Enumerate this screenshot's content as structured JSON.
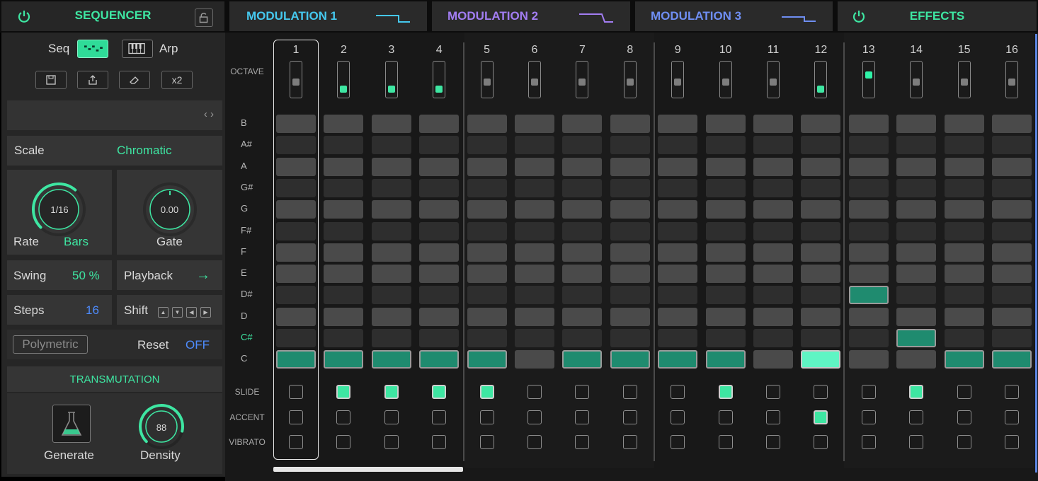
{
  "tabs": {
    "sequencer": "SEQUENCER",
    "modulation1": "MODULATION 1",
    "modulation2": "MODULATION 2",
    "modulation3": "MODULATION 3",
    "effects": "EFFECTS"
  },
  "left": {
    "seq_label": "Seq",
    "arp_label": "Arp",
    "x2_label": "x2",
    "preset_nav": "‹ ›",
    "scale_label": "Scale",
    "scale_value": "Chromatic",
    "rate_value": "1/16",
    "rate_label": "Rate",
    "rate_mode": "Bars",
    "gate_value": "0.00",
    "gate_label": "Gate",
    "swing_label": "Swing",
    "swing_value": "50 %",
    "playback_label": "Playback",
    "playback_arrow": "→",
    "steps_label": "Steps",
    "steps_value": "16",
    "shift_label": "Shift",
    "polymetric_label": "Polymetric",
    "reset_label": "Reset",
    "reset_value": "OFF",
    "transmutation": "TRANSMUTATION",
    "generate_label": "Generate",
    "density_value": "88",
    "density_label": "Density",
    "rate_fraction": 0.65,
    "density_fraction": 0.88
  },
  "grid": {
    "octave_label": "OCTAVE",
    "note_rows": [
      "B",
      "A#",
      "A",
      "G#",
      "G",
      "F#",
      "F",
      "E",
      "D#",
      "D",
      "C#",
      "C"
    ],
    "slide_label": "SLIDE",
    "accent_label": "ACCENT",
    "vibrato_label": "VIBRATO",
    "steps": [
      "1",
      "2",
      "3",
      "4",
      "5",
      "6",
      "7",
      "8",
      "9",
      "10",
      "11",
      "12",
      "13",
      "14",
      "15",
      "16"
    ],
    "octave_levels": [
      0,
      -1,
      -1,
      -1,
      0,
      0,
      0,
      0,
      0,
      0,
      0,
      -1,
      1,
      0,
      0,
      0
    ],
    "notes": [
      "C",
      "C",
      "C",
      "C",
      "C",
      null,
      "C",
      "C",
      "C",
      "C",
      null,
      "C",
      "D#",
      "C#",
      "C",
      "C"
    ],
    "bright_step": 12,
    "slide": [
      false,
      true,
      true,
      true,
      true,
      false,
      false,
      false,
      false,
      true,
      false,
      false,
      false,
      true,
      false,
      false
    ],
    "accent": [
      false,
      false,
      false,
      false,
      false,
      false,
      false,
      false,
      false,
      false,
      false,
      true,
      false,
      false,
      false,
      false
    ],
    "vibrato": [
      false,
      false,
      false,
      false,
      false,
      false,
      false,
      false,
      false,
      false,
      false,
      false,
      false,
      false,
      false,
      false
    ]
  },
  "colors": {
    "accent_green": "#3ee6a2",
    "mod1_cyan": "#45c8ee",
    "mod2_purple": "#a27df2",
    "mod3_blue": "#6f8ef2"
  },
  "icons": {
    "power": "power-icon",
    "lock": "lock-icon",
    "save": "save-icon",
    "export": "export-icon",
    "erase": "eraser-icon",
    "generate": "flask-icon"
  }
}
